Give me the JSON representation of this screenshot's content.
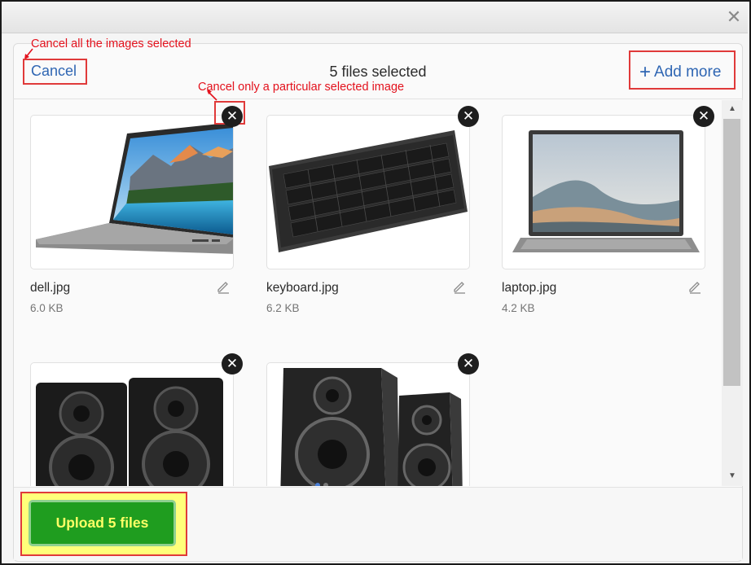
{
  "window": {
    "close_glyph": "✕"
  },
  "header": {
    "cancel_label": "Cancel",
    "title": "5 files selected",
    "add_more_label": "Add more",
    "add_more_icon": "plus-icon"
  },
  "annotations": {
    "cancel_all": "Cancel all the images selected",
    "cancel_one": "Cancel only a particular selected image",
    "color": "#e3111c"
  },
  "files": [
    {
      "name": "dell.jpg",
      "size": "6.0 KB",
      "image": "laptop-dell"
    },
    {
      "name": "keyboard.jpg",
      "size": "6.2 KB",
      "image": "keyboard"
    },
    {
      "name": "laptop.jpg",
      "size": "4.2 KB",
      "image": "laptop-surface"
    },
    {
      "name": "",
      "size": "",
      "image": "speakers-pair"
    },
    {
      "name": "",
      "size": "",
      "image": "speakers-stand"
    }
  ],
  "footer": {
    "upload_label": "Upload 5 files"
  },
  "colors": {
    "accent": "#2f66b3",
    "upload_bg": "#1f9d1f",
    "upload_text": "#ffff66",
    "highlight": "#ffff7a"
  }
}
